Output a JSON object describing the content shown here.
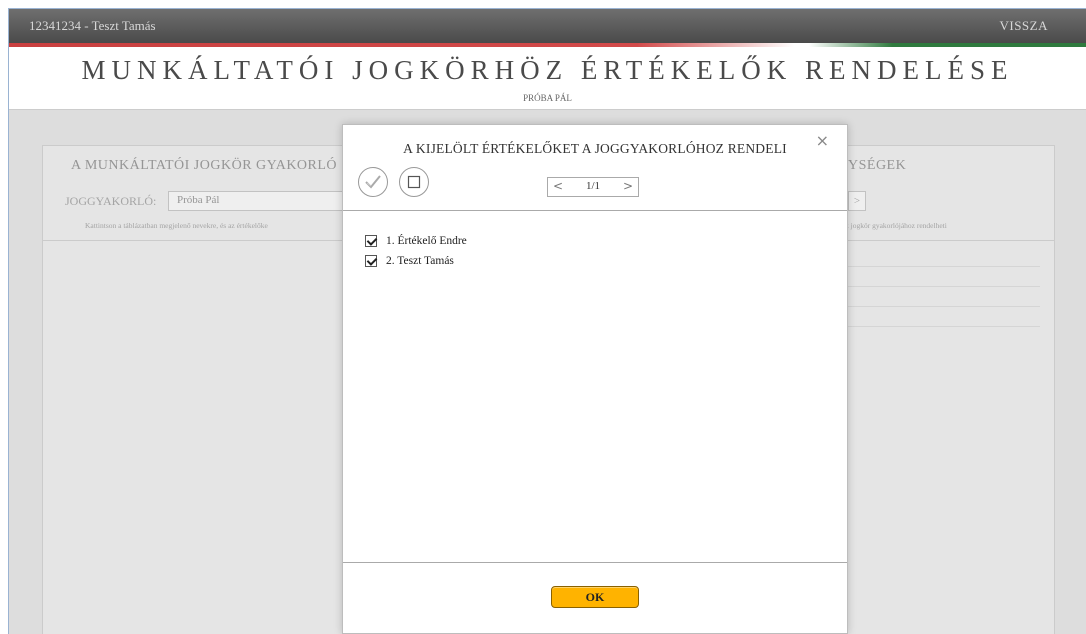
{
  "topbar": {
    "user": "12341234 - Teszt Tamás",
    "back": "VISSZA"
  },
  "header": {
    "title": "MUNKÁLTATÓI JOGKÖRHÖZ ÉRTÉKELŐK RENDELÉSE",
    "subtitle": "PRÓBA PÁL"
  },
  "left_panel": {
    "title": "A MUNKÁLTATÓI JOGKÖR GYAKORLÓ",
    "field_label": "JOGGYAKORLÓ:",
    "field_value": "Próba Pál",
    "hint": "Kattintson a táblázatban megjelenő nevekre, és az értékelőke"
  },
  "right_panel": {
    "title": "YSÉGEK",
    "arrow": ">",
    "hint": "k jogkör gyakorlójához rendelheti"
  },
  "modal": {
    "title": "A KIJELÖLT ÉRTÉKELŐKET A JOGGYAKORLÓHOZ RENDELI",
    "close": "×",
    "pager": {
      "prev": "<",
      "page": "1/1",
      "next": ">"
    },
    "items": [
      {
        "label": "1. Értékelő Endre",
        "checked": true
      },
      {
        "label": "2. Teszt Tamás",
        "checked": true
      }
    ],
    "ok": "OK"
  },
  "colors": {
    "accent_ok": "#ffb300",
    "stripe_red": "#d24a4a",
    "stripe_green": "#2f7a3e",
    "topbar": "#555555"
  },
  "icons": {
    "select_all": "check-circle-icon",
    "select_none": "square-circle-icon"
  }
}
